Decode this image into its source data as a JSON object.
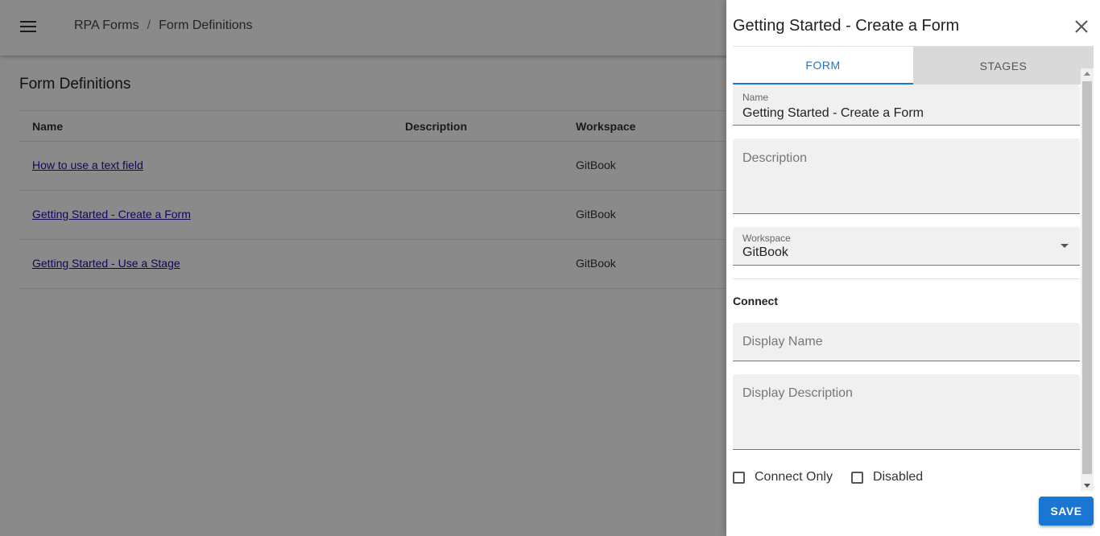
{
  "app_bar": {
    "menu_icon": "hamburger-menu-icon",
    "breadcrumb": [
      "RPA Forms",
      "Form Definitions"
    ],
    "separator": "/"
  },
  "page": {
    "title": "Form Definitions",
    "table": {
      "columns": [
        "Name",
        "Description",
        "Workspace"
      ],
      "rows": [
        {
          "name": "How to use a text field",
          "description": "",
          "workspace": "GitBook"
        },
        {
          "name": "Getting Started - Create a Form",
          "description": "",
          "workspace": "GitBook"
        },
        {
          "name": "Getting Started - Use a Stage",
          "description": "",
          "workspace": "GitBook"
        }
      ]
    }
  },
  "drawer": {
    "title": "Getting Started - Create a Form",
    "close_icon": "close-icon",
    "tabs": [
      {
        "label": "FORM",
        "active": true
      },
      {
        "label": "STAGES",
        "active": false
      }
    ],
    "fields": {
      "name": {
        "label": "Name",
        "value": "Getting Started - Create a Form"
      },
      "description": {
        "placeholder": "Description",
        "value": ""
      },
      "workspace": {
        "label": "Workspace",
        "value": "GitBook"
      },
      "connect_section_label": "Connect",
      "display_name": {
        "placeholder": "Display Name",
        "value": ""
      },
      "display_description": {
        "placeholder": "Display Description",
        "value": ""
      }
    },
    "checkboxes": [
      {
        "label": "Connect Only",
        "checked": false
      },
      {
        "label": "Disabled",
        "checked": false
      }
    ],
    "save_label": "SAVE"
  },
  "colors": {
    "accent": "#1976d2",
    "link": "#1a0dab",
    "overlay": "rgba(0,0,0,0.46)"
  }
}
